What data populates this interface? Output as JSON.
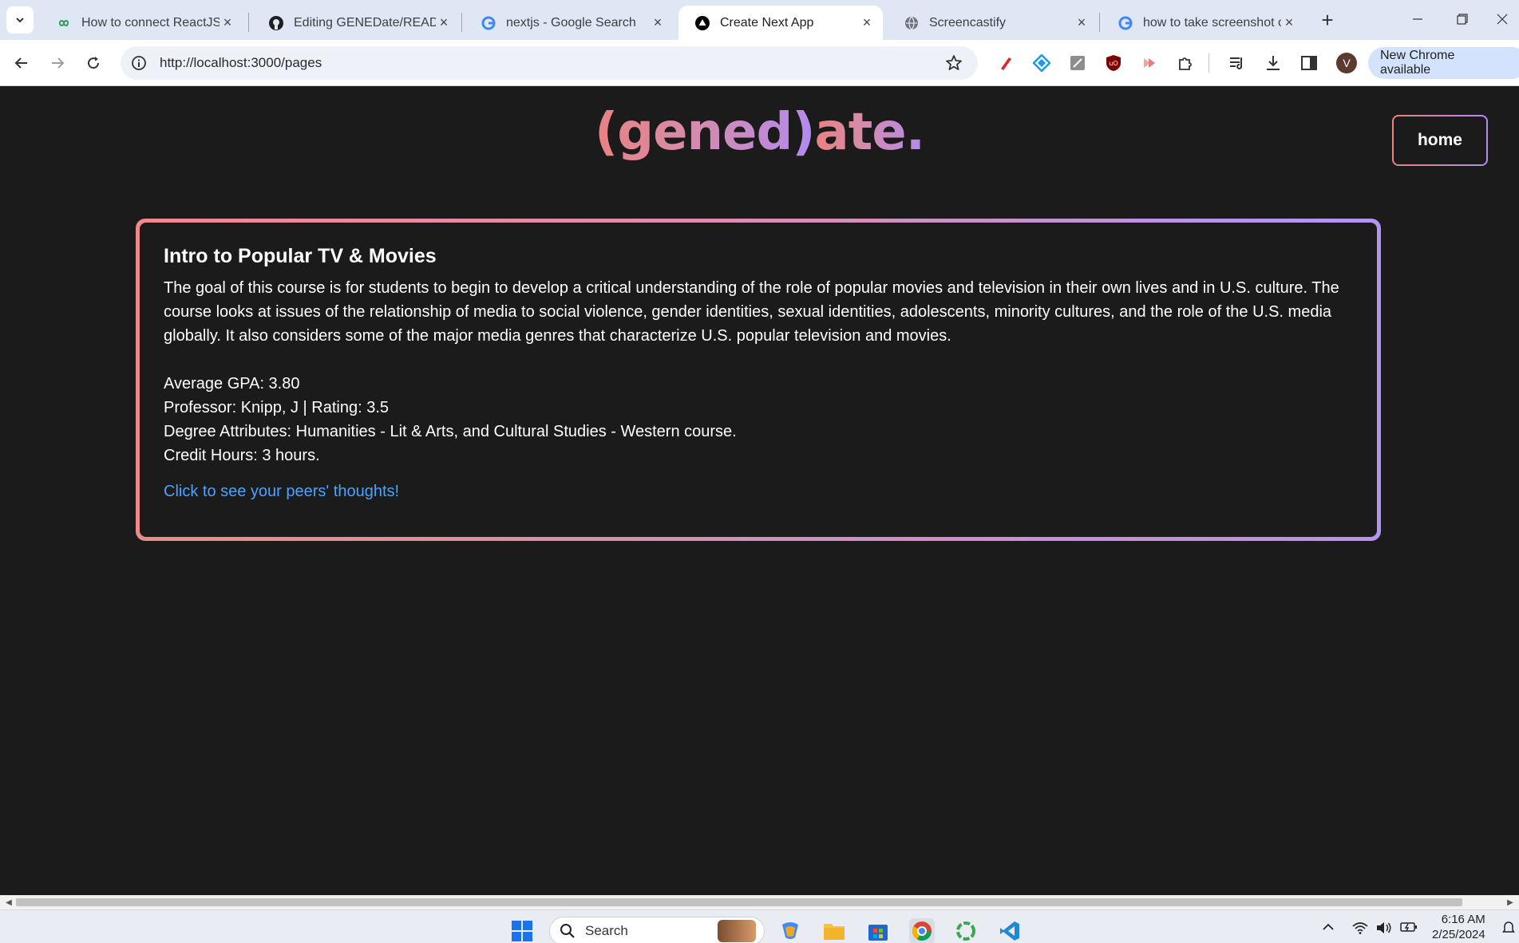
{
  "browser": {
    "tabs": [
      {
        "title": "How to connect ReactJS wi",
        "icon": "green-infinity-icon",
        "active": false
      },
      {
        "title": "Editing GENEDate/READMI",
        "icon": "github-icon",
        "active": false
      },
      {
        "title": "nextjs - Google Search",
        "icon": "google-icon",
        "active": false
      },
      {
        "title": "Create Next App",
        "icon": "nextjs-icon",
        "active": true
      },
      {
        "title": "Screencastify",
        "icon": "globe-icon",
        "active": false
      },
      {
        "title": "how to take screenshot on",
        "icon": "google-icon",
        "active": false
      }
    ],
    "url": "http://localhost:3000/pages",
    "profile_initial": "V",
    "update_chip": "New Chrome available",
    "extensions": [
      "red-pen-icon",
      "blue-diamond-icon",
      "gray-note-icon",
      "ublock-icon",
      "screencastify-icon",
      "puzzle-icon"
    ]
  },
  "page": {
    "brand_left": "(gened)",
    "brand_right": "ate.",
    "home_label": "home",
    "course": {
      "title": "Intro to Popular TV & Movies",
      "description": "The goal of this course is for students to begin to develop a critical understanding of the role of popular movies and television in their own lives and in U.S. culture. The course looks at issues of the relationship of media to social violence, gender identities, sexual identities, adolescents, minority cultures, and the role of the U.S. media globally. It also considers some of the major media genres that characterize U.S. popular television and movies.",
      "avg_gpa": "Average GPA: 3.80",
      "professor": "Professor: Knipp, J | Rating: 3.5",
      "attributes": "Degree Attributes: Humanities - Lit & Arts, and Cultural Studies - Western course.",
      "credit_hours": "Credit Hours: 3 hours.",
      "peer_link": "Click to see your peers' thoughts!"
    },
    "brand_colors": {
      "start": "#e98282",
      "end": "#b28bf0"
    },
    "link_color": "#4aa3ff"
  },
  "taskbar": {
    "search_placeholder": "Search",
    "time": "6:16 AM",
    "date": "2/25/2024"
  }
}
